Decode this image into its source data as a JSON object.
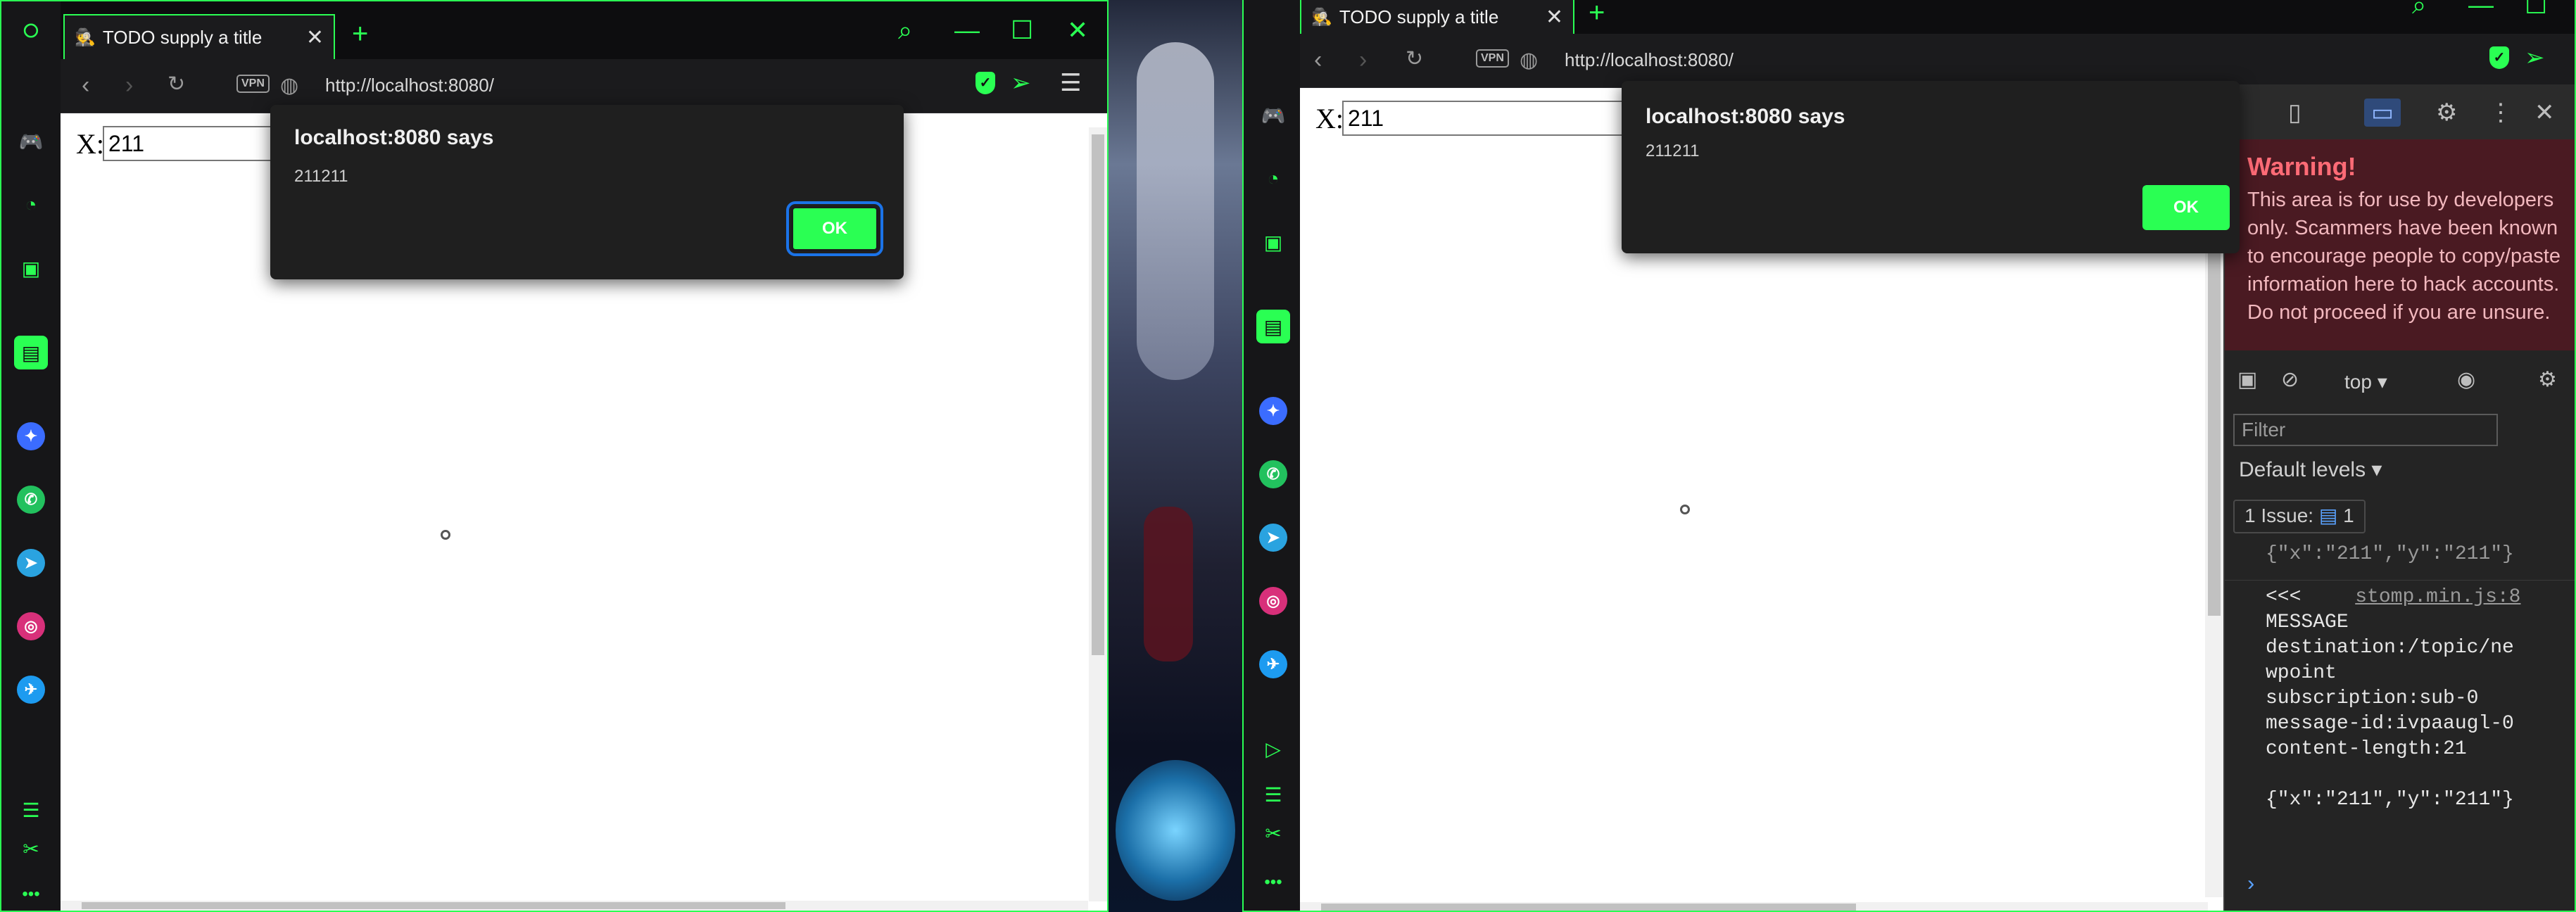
{
  "left": {
    "tab_title": "TODO supply a title",
    "url": "http://localhost:8080/",
    "vpn_label": "VPN",
    "input_label": "X:",
    "input_value": "211",
    "dialog": {
      "title": "localhost:8080 says",
      "message": "211211",
      "ok_label": "OK"
    }
  },
  "right": {
    "tab_title": "TODO supply a title",
    "url": "http://localhost:8080/",
    "vpn_label": "VPN",
    "input_label": "X:",
    "input_value": "211",
    "dialog": {
      "title": "localhost:8080 says",
      "message": "211211",
      "ok_label": "OK"
    },
    "devtools": {
      "warning_title": "Warning!",
      "warning_body": "This area is for use by developers only. Scammers have been known to encourage people to copy/paste information here to hack accounts. Do not proceed if you are unsure.",
      "context": "top",
      "filter_placeholder": "Filter",
      "levels": "Default levels",
      "issues_label": "1 Issue:",
      "issues_count": "1",
      "prev_line": "{\"x\":\"211\",\"y\":\"211\"}",
      "log_prefix": "<<<",
      "log_source": "stomp.min.js:8",
      "log_lines": "MESSAGE\ndestination:/topic/ne\nwpoint\nsubscription:sub-0\nmessage-id:ivpaaugl-0\ncontent-length:21\n\n{\"x\":\"211\",\"y\":\"211\"}"
    }
  },
  "colors": {
    "accent": "#2aff53",
    "warning_bg": "#4a1a22",
    "warning_text": "#ff6b76"
  },
  "icons": [
    "opera-logo",
    "gamepad-icon",
    "speed-icon",
    "bag-icon",
    "gx-corner-icon",
    "messenger-icon",
    "whatsapp-icon",
    "telegram-icon",
    "instagram-icon",
    "twitter-icon",
    "search-icon",
    "minimize-icon",
    "maximize-icon",
    "close-icon"
  ]
}
